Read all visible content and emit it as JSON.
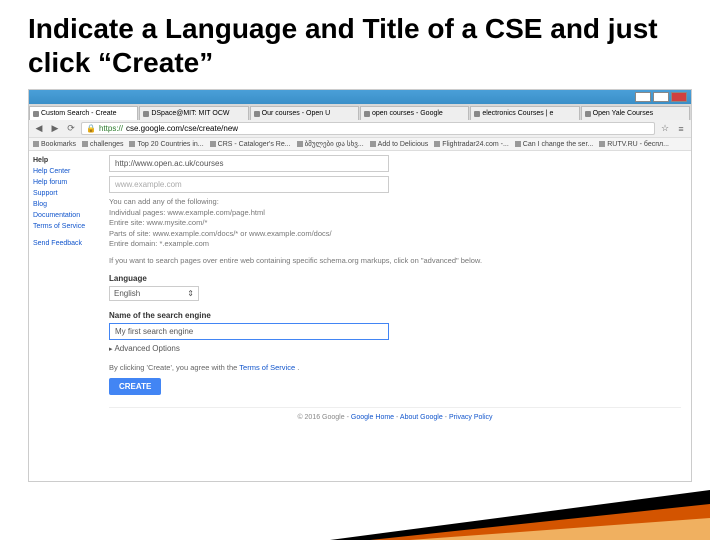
{
  "slide": {
    "title": "Indicate a Language and Title of a CSE and just click “Create”"
  },
  "tabs": [
    {
      "label": "Custom Search - Create"
    },
    {
      "label": "DSpace@MIT: MIT OCW"
    },
    {
      "label": "Our courses - Open U"
    },
    {
      "label": "open courses - Google"
    },
    {
      "label": "electronics Courses | e"
    },
    {
      "label": "Open Yale Courses"
    }
  ],
  "url": {
    "scheme": "https://",
    "rest": "cse.google.com/cse/create/new"
  },
  "bookmarks": [
    {
      "label": "Bookmarks"
    },
    {
      "label": "challenges"
    },
    {
      "label": "Top 20 Countries in..."
    },
    {
      "label": "CRS - Cataloger's Re..."
    },
    {
      "label": "ბმულები და სხვ..."
    },
    {
      "label": "Add to Delicious"
    },
    {
      "label": "Flightradar24.com -..."
    },
    {
      "label": "Can I change the ser..."
    },
    {
      "label": "RUTV.RU - беспл..."
    }
  ],
  "sidebar": {
    "help": "Help",
    "items": [
      "Help Center",
      "Help forum",
      "Support",
      "Blog",
      "Documentation",
      "Terms of Service"
    ],
    "feedback": "Send Feedback"
  },
  "form": {
    "sites_value": "http://www.open.ac.uk/courses",
    "sites_placeholder": "www.example.com",
    "help_intro": "You can add any of the following:",
    "help_lines": [
      "Individual pages: www.example.com/page.html",
      "Entire site: www.mysite.com/*",
      "Parts of site: www.example.com/docs/* or www.example.com/docs/",
      "Entire domain: *.example.com"
    ],
    "help_schema": "If you want to search pages over entire web containing specific schema.org markups, click on \"advanced\" below.",
    "language_label": "Language",
    "language_value": "English",
    "name_label": "Name of the search engine",
    "name_value": "My first search engine",
    "advanced": "Advanced Options",
    "terms_prefix": "By clicking 'Create', you agree with the ",
    "terms_link": "Terms of Service",
    "terms_suffix": " .",
    "create_btn": "CREATE"
  },
  "footer": {
    "copyright": "© 2016 Google",
    "links": [
      "Google Home",
      "About Google",
      "Privacy Policy"
    ]
  }
}
